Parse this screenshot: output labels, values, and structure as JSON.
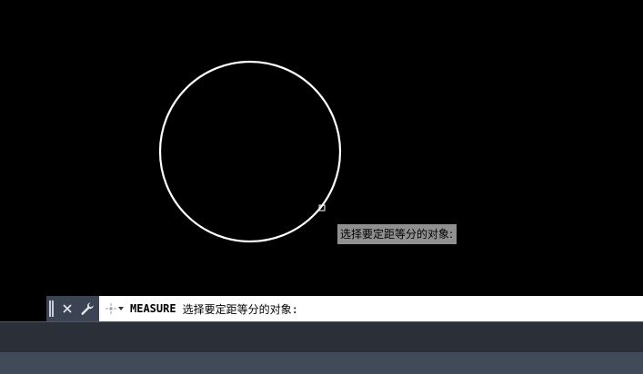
{
  "drawing": {
    "shape": "circle",
    "stroke_color": "#ffffff",
    "background_color": "#000000",
    "pickbox_color": "#ffffff"
  },
  "cursor_tooltip": {
    "text": "选择要定距等分的对象:"
  },
  "command_line": {
    "close_icon": "close-icon",
    "customize_icon": "wrench-icon",
    "recent_commands_icon": "command-prompt-icon",
    "command_name": "MEASURE",
    "prompt_text": "选择要定距等分的对象:"
  },
  "colors": {
    "command_tools_bg": "#3b4453",
    "command_input_bg": "#ffffff",
    "tooltip_bg": "#909090",
    "status_strip_bg": "#2b3038",
    "lower_strip_bg": "#414a59"
  }
}
